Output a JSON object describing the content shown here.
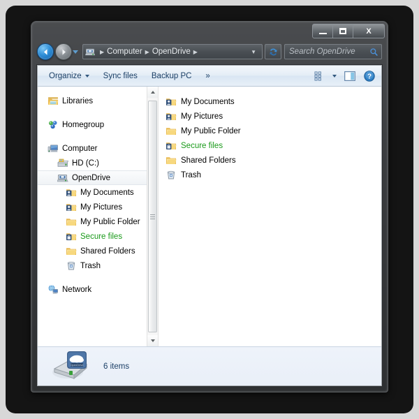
{
  "window": {
    "controls": {
      "minimize": "Minimize",
      "maximize": "Maximize",
      "close": "X"
    },
    "nav": {
      "back": "Back",
      "forward": "Forward",
      "history": "Recent pages"
    }
  },
  "address": {
    "icon": "opendrive-drive-icon",
    "crumbs": [
      "Computer",
      "OpenDrive"
    ],
    "separator": "▶",
    "dropdown": "▼",
    "refresh": "Refresh"
  },
  "search": {
    "placeholder": "Search OpenDrive",
    "value": "",
    "icon": "search-icon"
  },
  "commandbar": {
    "organize": "Organize",
    "sync_files": "Sync files",
    "backup_pc": "Backup PC",
    "overflow": "»",
    "change_view": "Change your view",
    "preview_pane": "Show the preview pane",
    "help": "Help"
  },
  "navpane": {
    "items": [
      {
        "label": "Libraries",
        "icon": "libraries-icon",
        "indent": 0,
        "gap": false,
        "selected": false,
        "green": false
      },
      {
        "label": "Homegroup",
        "icon": "homegroup-icon",
        "indent": 0,
        "gap": true,
        "selected": false,
        "green": false
      },
      {
        "label": "Computer",
        "icon": "computer-icon",
        "indent": 0,
        "gap": true,
        "selected": false,
        "green": false
      },
      {
        "label": "HD (C:)",
        "icon": "harddisk-icon",
        "indent": 1,
        "gap": false,
        "selected": false,
        "green": false
      },
      {
        "label": "OpenDrive",
        "icon": "opendrive-drive-icon",
        "indent": 1,
        "gap": false,
        "selected": true,
        "green": false
      },
      {
        "label": "My Documents",
        "icon": "folder-user-icon",
        "indent": 2,
        "gap": false,
        "selected": false,
        "green": false
      },
      {
        "label": "My Pictures",
        "icon": "folder-user-icon",
        "indent": 2,
        "gap": false,
        "selected": false,
        "green": false
      },
      {
        "label": "My Public Folder",
        "icon": "folder-icon",
        "indent": 2,
        "gap": false,
        "selected": false,
        "green": false
      },
      {
        "label": "Secure files",
        "icon": "folder-lock-icon",
        "indent": 2,
        "gap": false,
        "selected": false,
        "green": true
      },
      {
        "label": "Shared Folders",
        "icon": "folder-icon",
        "indent": 2,
        "gap": false,
        "selected": false,
        "green": false
      },
      {
        "label": "Trash",
        "icon": "trash-icon",
        "indent": 2,
        "gap": false,
        "selected": false,
        "green": false
      },
      {
        "label": "Network",
        "icon": "network-icon",
        "indent": 0,
        "gap": true,
        "selected": false,
        "green": false
      }
    ]
  },
  "content": {
    "items": [
      {
        "label": "My Documents",
        "icon": "folder-user-icon",
        "green": false
      },
      {
        "label": "My Pictures",
        "icon": "folder-user-icon",
        "green": false
      },
      {
        "label": "My Public Folder",
        "icon": "folder-icon",
        "green": false
      },
      {
        "label": "Secure files",
        "icon": "folder-lock-icon",
        "green": true
      },
      {
        "label": "Shared Folders",
        "icon": "folder-icon",
        "green": false
      },
      {
        "label": "Trash",
        "icon": "trash-icon",
        "green": false
      }
    ]
  },
  "statusbar": {
    "icon": "opendrive-cloud-drive-icon",
    "text": "6 items"
  },
  "colors": {
    "green_text": "#1a9a1a",
    "command_text": "#1b3f66",
    "folder_yellow": "#f6d98a",
    "accent_blue": "#2f8fd8"
  }
}
